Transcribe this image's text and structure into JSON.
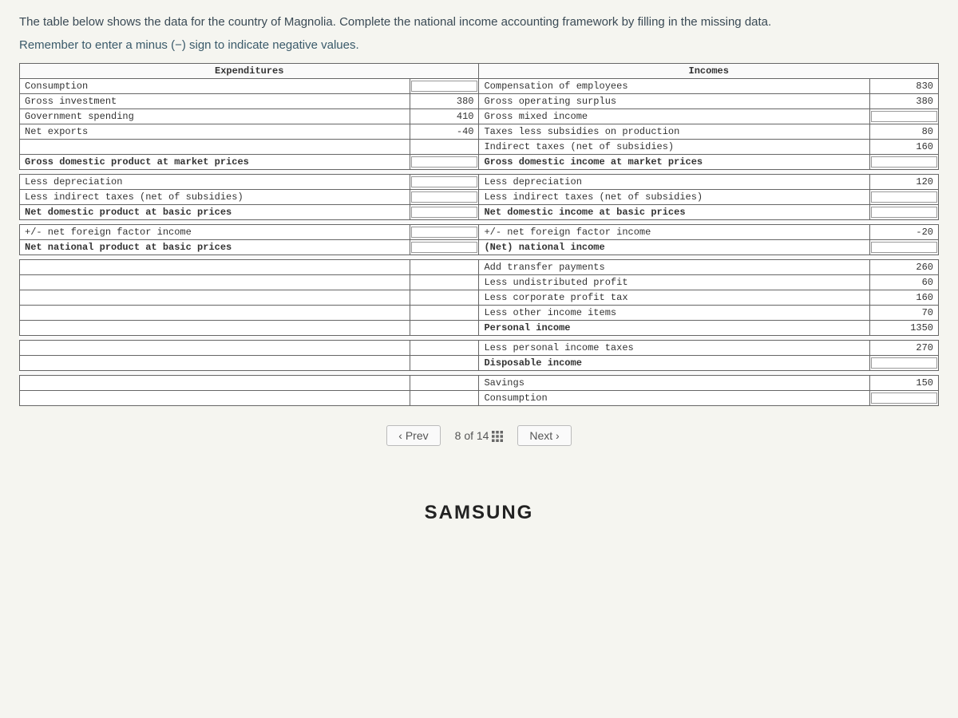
{
  "instructions": "The table below shows the data for the country of Magnolia. Complete the national income accounting framework by filling in the missing data.",
  "reminder": "Remember to enter a minus (−) sign to indicate negative values.",
  "headers": {
    "expenditures": "Expenditures",
    "incomes": "Incomes"
  },
  "exp": {
    "consumption": "Consumption",
    "gross_investment": "Gross investment",
    "gross_investment_val": "380",
    "government_spending": "Government spending",
    "government_spending_val": "410",
    "net_exports": "Net exports",
    "net_exports_val": "-40",
    "gdp_market": "Gross domestic product at market prices",
    "less_depreciation": "Less depreciation",
    "less_indirect_taxes": "Less indirect taxes (net of subsidies)",
    "ndp_basic": "Net domestic product at basic prices",
    "net_foreign_factor": "+/- net foreign factor income",
    "nnp_basic": "Net national product at basic prices"
  },
  "inc": {
    "compensation": "Compensation of employees",
    "compensation_val": "830",
    "gross_operating_surplus": "Gross operating surplus",
    "gross_operating_surplus_val": "380",
    "gross_mixed_income": "Gross mixed income",
    "taxes_less_subsidies": "Taxes less subsidies on production",
    "taxes_less_subsidies_val": "80",
    "indirect_taxes": "Indirect taxes (net of subsidies)",
    "indirect_taxes_val": "160",
    "gdi_market": "Gross domestic income at market prices",
    "less_depreciation": "Less depreciation",
    "less_depreciation_val": "120",
    "less_indirect_taxes": "Less indirect taxes (net of subsidies)",
    "ndi_basic": "Net domestic income at basic prices",
    "net_foreign_factor": "+/- net foreign factor income",
    "net_foreign_factor_val": "-20",
    "national_income": "(Net) national income",
    "add_transfer": "Add transfer payments",
    "add_transfer_val": "260",
    "less_undistributed": "Less undistributed profit",
    "less_undistributed_val": "60",
    "less_corporate_tax": "Less corporate profit tax",
    "less_corporate_tax_val": "160",
    "less_other_items": "Less other income items",
    "less_other_items_val": "70",
    "personal_income": "Personal income",
    "personal_income_val": "1350",
    "less_personal_taxes": "Less personal income taxes",
    "less_personal_taxes_val": "270",
    "disposable_income": "Disposable income",
    "savings": "Savings",
    "savings_val": "150",
    "consumption": "Consumption"
  },
  "nav": {
    "prev": "Prev",
    "next": "Next",
    "page_current": "8",
    "page_of": "of",
    "page_total": "14"
  },
  "brand": "SAMSUNG"
}
